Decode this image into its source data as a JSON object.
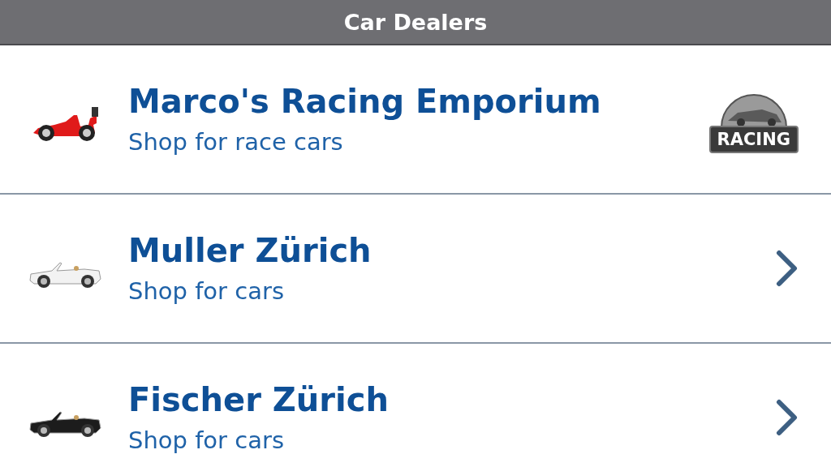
{
  "header": {
    "title": "Car Dealers"
  },
  "dealers": [
    {
      "name": "Marco's Racing Emporium",
      "subtitle": "Shop for race cars",
      "icon": {
        "kind": "race-car",
        "color": "#e01a1a"
      },
      "accessory": {
        "kind": "badge",
        "label": "RACING"
      }
    },
    {
      "name": "Muller Zürich",
      "subtitle": "Shop for cars",
      "icon": {
        "kind": "convertible",
        "color": "#f2f2f2"
      },
      "accessory": {
        "kind": "chevron"
      }
    },
    {
      "name": "Fischer Zürich",
      "subtitle": "Shop for cars",
      "icon": {
        "kind": "convertible",
        "color": "#1c1c1c"
      },
      "accessory": {
        "kind": "chevron"
      }
    }
  ]
}
